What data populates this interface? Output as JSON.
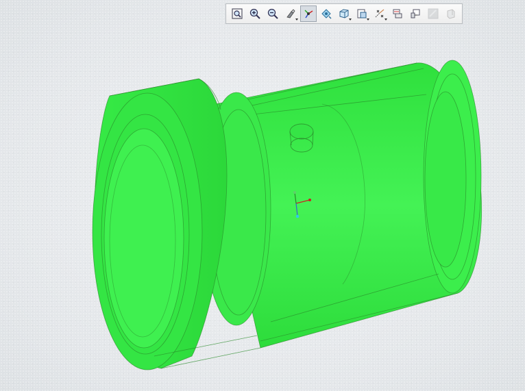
{
  "viewport": {
    "background_color": "#e6e9ec",
    "model_color": "#33ee44",
    "edge_color": "#2a8a2a"
  },
  "toolbar": {
    "buttons": [
      {
        "name": "refit-button",
        "icon": "zoom-fit-icon",
        "has_dropdown": false,
        "active": false,
        "disabled": false
      },
      {
        "name": "zoom-in-button",
        "icon": "zoom-in-icon",
        "has_dropdown": false,
        "active": false,
        "disabled": false
      },
      {
        "name": "zoom-out-button",
        "icon": "zoom-out-icon",
        "has_dropdown": false,
        "active": false,
        "disabled": false
      },
      {
        "name": "repaint-button",
        "icon": "repaint-icon",
        "has_dropdown": true,
        "active": false,
        "disabled": false
      },
      {
        "name": "spin-center-button",
        "icon": "spin-center-icon",
        "has_dropdown": false,
        "active": true,
        "disabled": false
      },
      {
        "name": "orient-mode-button",
        "icon": "orient-mode-icon",
        "has_dropdown": false,
        "active": false,
        "disabled": false
      },
      {
        "name": "display-style-button",
        "icon": "display-style-icon",
        "has_dropdown": true,
        "active": false,
        "disabled": false
      },
      {
        "name": "saved-views-button",
        "icon": "saved-views-icon",
        "has_dropdown": true,
        "active": false,
        "disabled": false
      },
      {
        "name": "datum-display-button",
        "icon": "datum-display-icon",
        "has_dropdown": true,
        "active": false,
        "disabled": false
      },
      {
        "name": "view-manager-button",
        "icon": "view-manager-icon",
        "has_dropdown": false,
        "active": false,
        "disabled": false
      },
      {
        "name": "annotation-display-button",
        "icon": "annotation-display-icon",
        "has_dropdown": false,
        "active": false,
        "disabled": false
      },
      {
        "name": "appearance-button",
        "icon": "appearance-icon",
        "has_dropdown": false,
        "active": false,
        "disabled": true
      },
      {
        "name": "section-button",
        "icon": "section-icon",
        "has_dropdown": false,
        "active": false,
        "disabled": true
      }
    ]
  }
}
